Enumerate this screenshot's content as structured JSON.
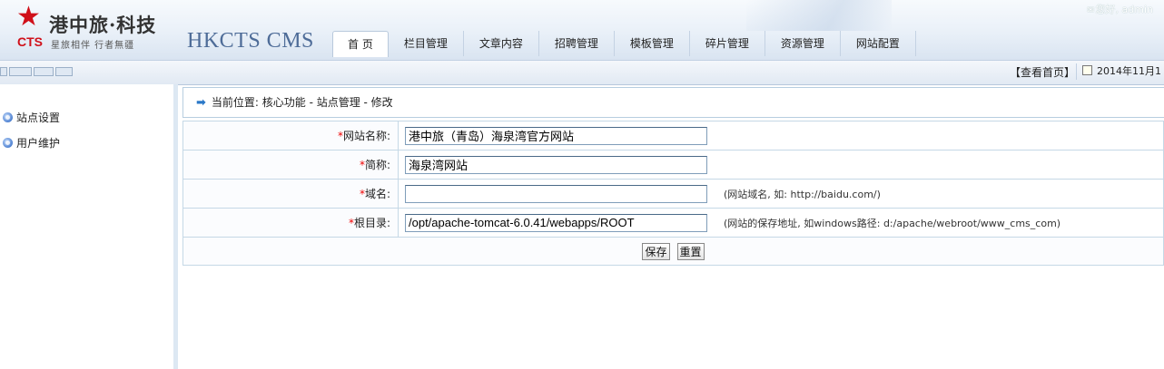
{
  "header": {
    "logo_mark": "CTS",
    "logo_cn": "港中旅·科技",
    "logo_slogan": "星旅相伴 行者無疆",
    "cms_title": "HKCTS CMS",
    "greeting": "您好, admin"
  },
  "nav": {
    "items": [
      {
        "label": "首 页",
        "active": true
      },
      {
        "label": "栏目管理"
      },
      {
        "label": "文章内容"
      },
      {
        "label": "招聘管理"
      },
      {
        "label": "模板管理"
      },
      {
        "label": "碎片管理"
      },
      {
        "label": "资源管理"
      },
      {
        "label": "网站配置"
      }
    ]
  },
  "toolbar": {
    "view_home": "【查看首页】",
    "date": "2014年11月1"
  },
  "sidebar": {
    "items": [
      {
        "label": "站点设置"
      },
      {
        "label": "用户维护"
      }
    ]
  },
  "breadcrumb": {
    "text": "当前位置:  核心功能 - 站点管理 - 修改"
  },
  "form": {
    "required_mark": "*",
    "rows": [
      {
        "label": "网站名称:",
        "value": "港中旅（青岛）海泉湾官方网站",
        "hint": ""
      },
      {
        "label": "简称:",
        "value": "海泉湾网站",
        "hint": ""
      },
      {
        "label": "域名:",
        "value": "",
        "hint": "(网站域名, 如: http://baidu.com/)"
      },
      {
        "label": "根目录:",
        "value": "/opt/apache-tomcat-6.0.41/webapps/ROOT",
        "hint": "(网站的保存地址, 如windows路径:  d:/apache/webroot/www_cms_com)"
      }
    ],
    "save_label": "保存",
    "reset_label": "重置"
  },
  "colors": {
    "accent": "#2a78c8",
    "required": "#e00000",
    "logo_red": "#d0101a",
    "cms_title": "#4e6c98"
  },
  "icons": {
    "nav_logo": "star-icon",
    "crumb": "arrow-right-icon",
    "sidebar_bullet": "circle-arrow-icon",
    "greeting": "mail-icon",
    "date": "calendar-icon"
  }
}
